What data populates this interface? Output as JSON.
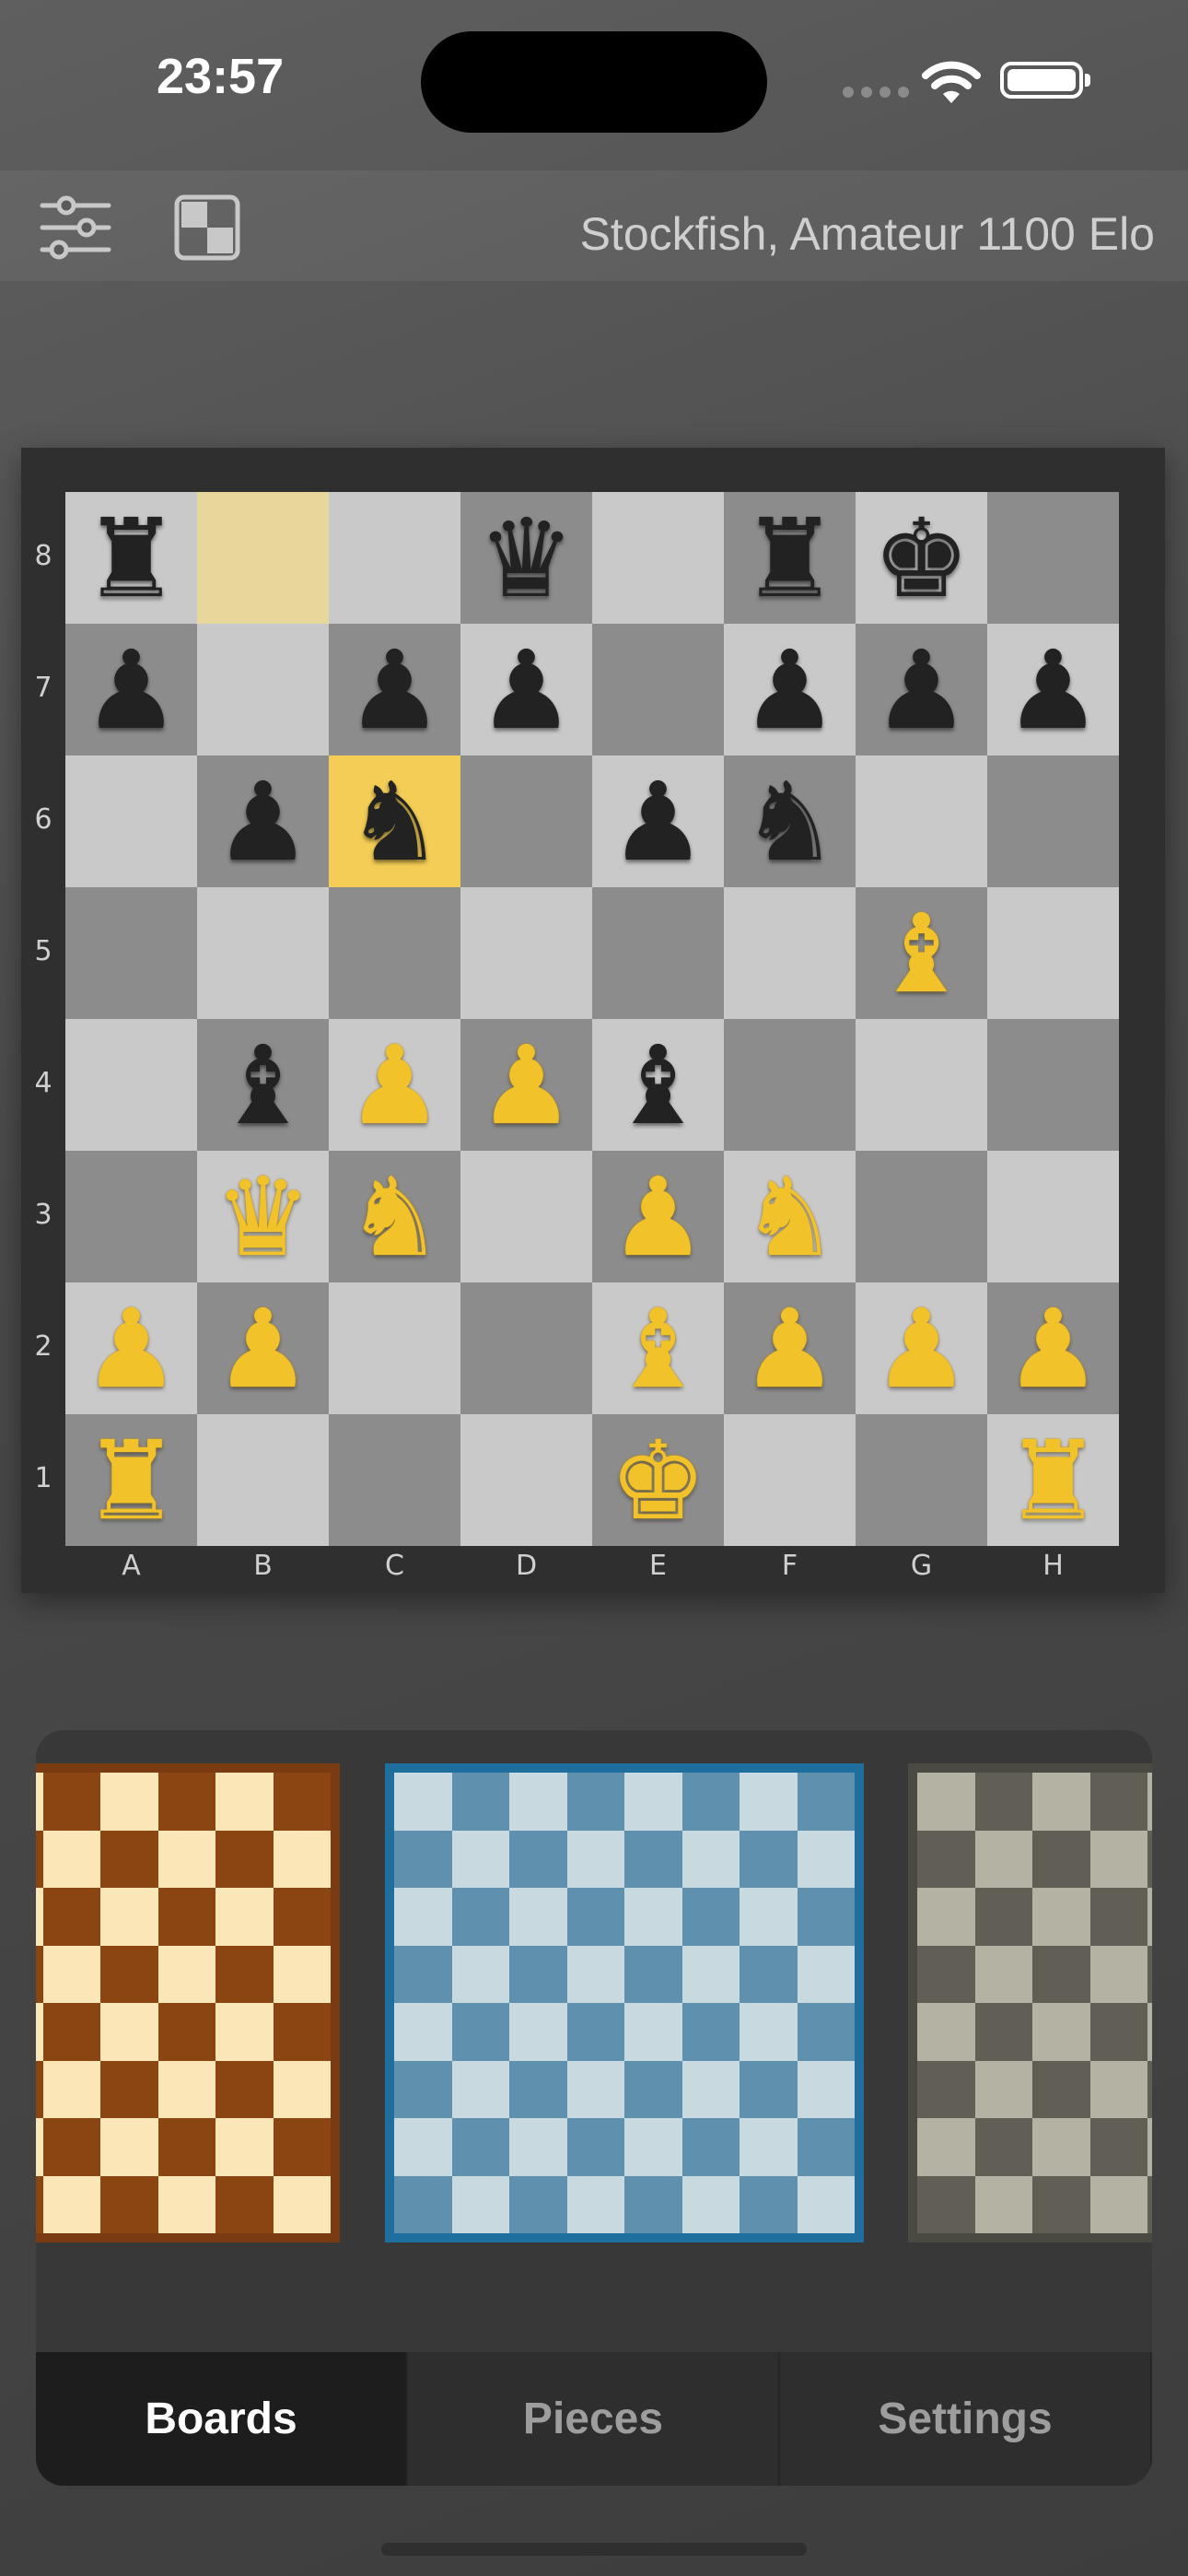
{
  "status": {
    "time": "23:57"
  },
  "toolbar": {
    "engine_label": "Stockfish, Amateur 1100 Elo"
  },
  "board": {
    "ranks": [
      "8",
      "7",
      "6",
      "5",
      "4",
      "3",
      "2",
      "1"
    ],
    "files": [
      "A",
      "B",
      "C",
      "D",
      "E",
      "F",
      "G",
      "H"
    ],
    "position": [
      [
        "br",
        "",
        "",
        "bq",
        "",
        "br",
        "bk",
        ""
      ],
      [
        "bp",
        "",
        "bp",
        "bp",
        "",
        "bp",
        "bp",
        "bp"
      ],
      [
        "",
        "bp",
        "bn",
        "",
        "bp",
        "bn",
        "",
        ""
      ],
      [
        "",
        "",
        "",
        "",
        "",
        "",
        "wb",
        ""
      ],
      [
        "",
        "bb",
        "wp",
        "wp",
        "bb",
        "",
        "",
        ""
      ],
      [
        "",
        "wq",
        "wn",
        "",
        "wp",
        "wn",
        "",
        ""
      ],
      [
        "wp",
        "wp",
        "",
        "",
        "wb",
        "wp",
        "wp",
        "wp"
      ],
      [
        "wr",
        "",
        "",
        "",
        "wk",
        "",
        "",
        "wr"
      ]
    ],
    "highlight_from": "b8",
    "highlight_to": "c6",
    "colors": {
      "light": "#c9c9c9",
      "dark": "#8c8c8c"
    }
  },
  "themes": [
    {
      "name": "wood",
      "light": "#fbe6b8",
      "dark": "#8b4513",
      "border": "#7a3a12"
    },
    {
      "name": "blue",
      "light": "#c9d9e0",
      "dark": "#5f90ad",
      "border": "#1f6f9e",
      "selected": true
    },
    {
      "name": "gray",
      "light": "#b4b2a2",
      "dark": "#615f55",
      "border": "#4a4a42"
    }
  ],
  "tabs": [
    {
      "label": "Boards",
      "active": true
    },
    {
      "label": "Pieces",
      "active": false
    },
    {
      "label": "Settings",
      "active": false
    }
  ]
}
